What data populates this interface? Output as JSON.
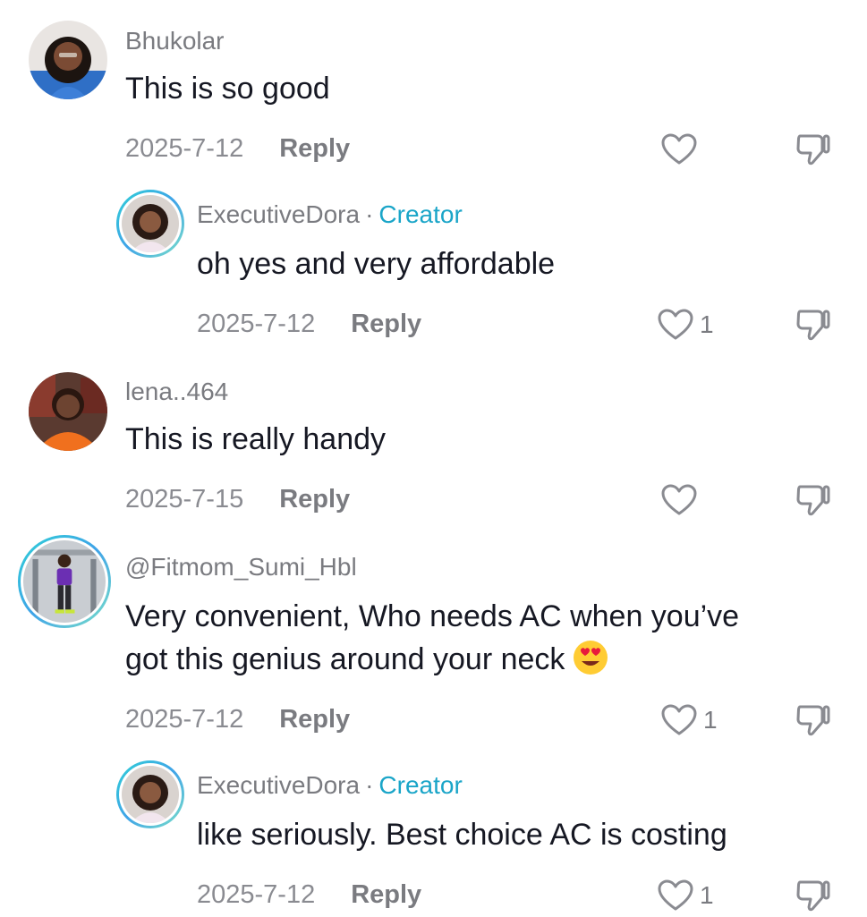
{
  "comments": [
    {
      "username": "Bhukolar",
      "text": "This is so good",
      "date": "2025-7-12",
      "reply_label": "Reply",
      "like_count": ""
    },
    {
      "username": "ExecutiveDora",
      "separator": "·",
      "badge": "Creator",
      "text": "oh yes and very affordable",
      "date": "2025-7-12",
      "reply_label": "Reply",
      "like_count": "1"
    },
    {
      "username": "lena..464",
      "text": "This is really handy",
      "date": "2025-7-15",
      "reply_label": "Reply",
      "like_count": ""
    },
    {
      "username": "@Fitmom_Sumi_Hbl",
      "text_line1": "Very convenient, Who needs AC when you’ve",
      "text_line2": "got this genius around your neck",
      "emoji": "heart-eyes-emoji",
      "date": "2025-7-12",
      "reply_label": "Reply",
      "like_count": "1"
    },
    {
      "username": "ExecutiveDora",
      "separator": "·",
      "badge": "Creator",
      "text": "like seriously. Best choice AC is costing",
      "date": "2025-7-12",
      "reply_label": "Reply",
      "like_count": "1"
    }
  ],
  "icons": {
    "like": "heart-outline-icon",
    "dislike": "thumbs-down-icon"
  },
  "colors": {
    "creator_badge": "#1aa5c8",
    "meta_text": "#8a8b91",
    "avatar_ring": "#2fd0d6"
  }
}
